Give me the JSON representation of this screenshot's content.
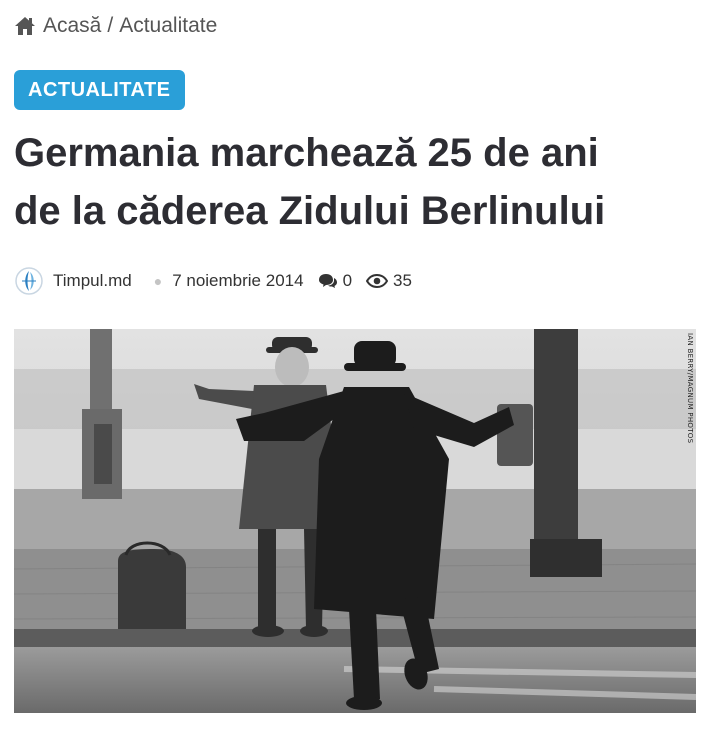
{
  "breadcrumb": {
    "icon": "home-icon",
    "home_label": "Acasă",
    "separator": "/",
    "current_label": "Actualitate"
  },
  "article": {
    "category": "ACTUALITATE",
    "category_color": "#2a9fd8",
    "title_line1": "Germania marchează 25 de ani",
    "title_line2": "de la căderea Zidului Berlinului",
    "author": "Timpul.md",
    "date": "7 noiembrie 2014",
    "comments_count": "0",
    "views_count": "35",
    "photo_credit": "IAN BERRY/MAGNUM PHOTOS"
  }
}
